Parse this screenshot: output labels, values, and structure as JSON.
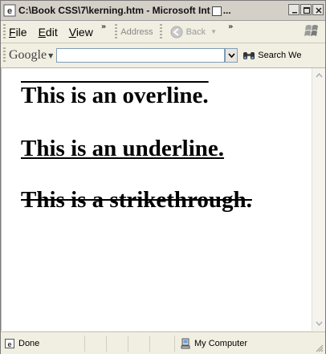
{
  "window": {
    "title": "C:\\Book CSS\\7\\kerning.htm - Microsoft Int",
    "title_suffix": "..."
  },
  "menubar": {
    "items": [
      "File",
      "Edit",
      "View"
    ],
    "overflow": "»",
    "address_label": "Address",
    "back_label": "Back",
    "overflow2": "»"
  },
  "googlebar": {
    "logo": "Google",
    "search_value": "",
    "search_button": "Search We"
  },
  "content": {
    "lines": [
      "This is an overline.",
      "This is an underline.",
      "This is a strikethrough."
    ]
  },
  "statusbar": {
    "status": "Done",
    "zone": "My Computer"
  },
  "colors": {
    "chrome": "#f1efe2",
    "titlebar": "#d4d0c8",
    "page": "#ffffff"
  }
}
